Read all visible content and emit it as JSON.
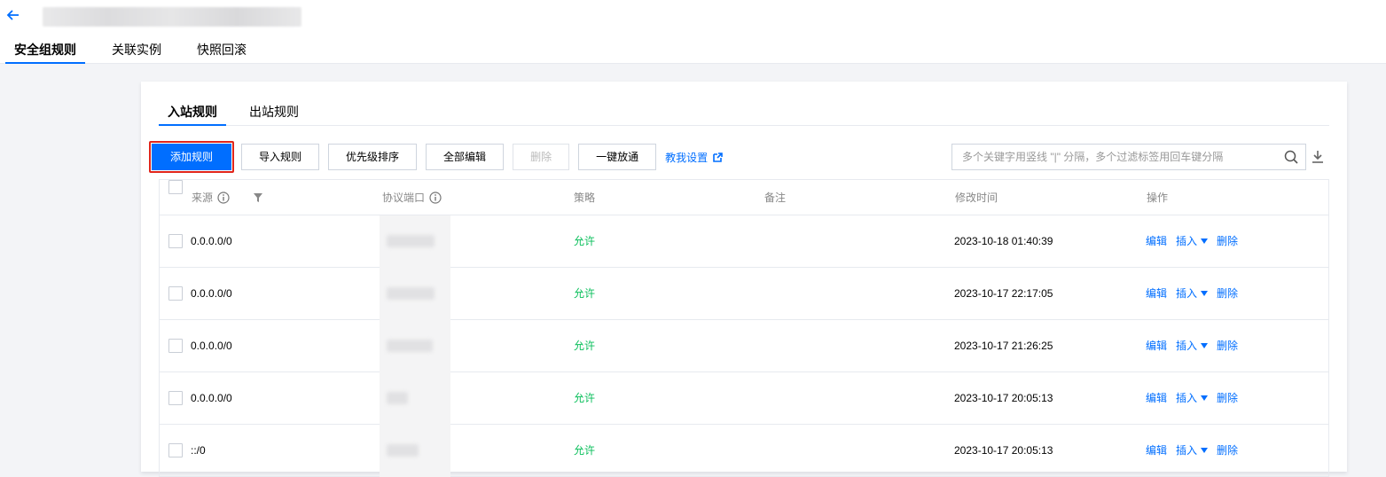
{
  "header": {
    "page_tabs": [
      {
        "label": "安全组规则",
        "active": true
      },
      {
        "label": "关联实例",
        "active": false
      },
      {
        "label": "快照回滚",
        "active": false
      }
    ]
  },
  "rules": {
    "sub_tabs": [
      {
        "label": "入站规则",
        "active": true
      },
      {
        "label": "出站规则",
        "active": false
      }
    ],
    "toolbar": {
      "add_rule": "添加规则",
      "import_rules": "导入规则",
      "priority_sort": "优先级排序",
      "edit_all": "全部编辑",
      "delete": "删除",
      "one_click_allow": "一键放通",
      "teach_me": "教我设置"
    },
    "search": {
      "placeholder": "多个关键字用竖线 \"|\" 分隔，多个过滤标签用回车键分隔"
    },
    "columns": {
      "source": "来源",
      "protocol_port": "协议端口",
      "policy": "策略",
      "remark": "备注",
      "modified_time": "修改时间",
      "actions": "操作"
    },
    "row_actions": {
      "edit": "编辑",
      "insert": "插入",
      "delete": "删除"
    },
    "rows": [
      {
        "source": "0.0.0.0/0",
        "policy": "允许",
        "remark": "",
        "modified_time": "2023-10-18 01:40:39"
      },
      {
        "source": "0.0.0.0/0",
        "policy": "允许",
        "remark": "",
        "modified_time": "2023-10-17 22:17:05"
      },
      {
        "source": "0.0.0.0/0",
        "policy": "允许",
        "remark": "",
        "modified_time": "2023-10-17 21:26:25"
      },
      {
        "source": "0.0.0.0/0",
        "policy": "允许",
        "remark": "",
        "modified_time": "2023-10-17 20:05:13"
      },
      {
        "source": "::/0",
        "policy": "允许",
        "remark": "",
        "modified_time": "2023-10-17 20:05:13"
      }
    ]
  },
  "colors": {
    "primary": "#006eff",
    "allow": "#0abf5b",
    "highlight_border": "#e1251b"
  }
}
